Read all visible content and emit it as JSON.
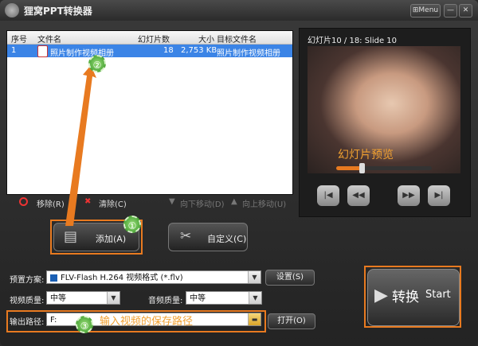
{
  "window": {
    "title": "狸窝PPT转换器",
    "menu_label": "Menu",
    "minimize": "—",
    "close": "✕"
  },
  "list": {
    "headers": [
      "序号",
      "文件名",
      "幻灯片数",
      "大小",
      "目标文件名"
    ],
    "rows": [
      {
        "index": "1",
        "filename": "照片制作视频相册",
        "slides": "18",
        "size": "2,753 KB",
        "target": "照片制作视频相册"
      }
    ]
  },
  "list_toolbar": {
    "remove": "移除(R)",
    "clear": "清除(C)",
    "move_down": "向下移动(D)",
    "move_up": "向上移动(U)"
  },
  "buttons": {
    "add": "添加(A)",
    "customize": "自定义(C)",
    "settings": "设置(S)",
    "open": "打开(O)",
    "convert_cn": "转换",
    "convert_en": "Start"
  },
  "preview": {
    "label": "幻灯片10 / 18: Slide 10",
    "caption": "幻灯片预览",
    "progress": 0.27
  },
  "form": {
    "preset_label": "预置方案:",
    "preset_value": "FLV-Flash H.264 视频格式 (*.flv)",
    "video_quality_label": "视频质量:",
    "video_quality_value": "中等",
    "audio_quality_label": "音频质量:",
    "audio_quality_value": "中等",
    "output_label": "输出路径:",
    "output_value": "F:",
    "output_annotation": "输入视频的保存路径"
  },
  "annotations": {
    "step1": "①",
    "step2": "②",
    "step3": "③"
  },
  "colors": {
    "accent": "#e87a20",
    "selection": "#3b84e6"
  }
}
